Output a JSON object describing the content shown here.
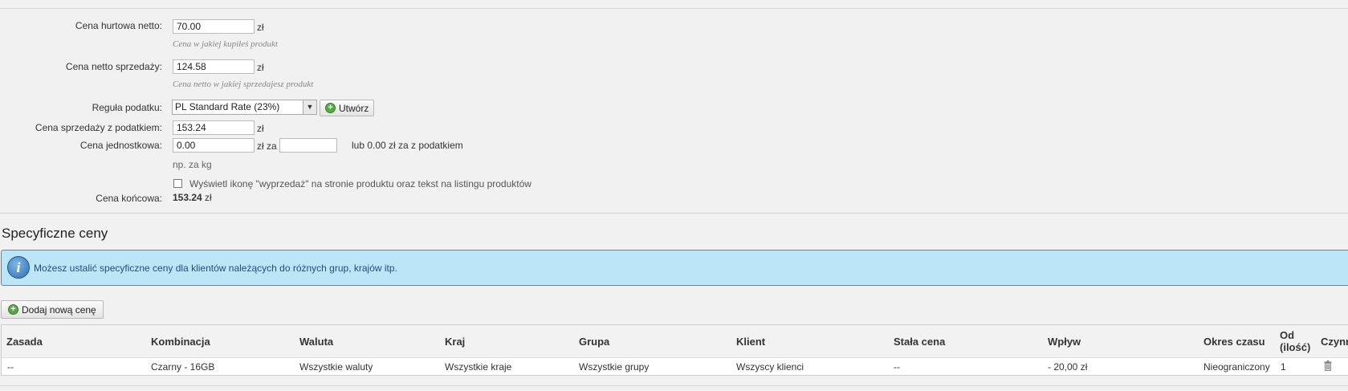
{
  "pricing": {
    "wholesale_label": "Cena hurtowa netto:",
    "wholesale_value": "70.00",
    "currency": "zł",
    "wholesale_hint": "Cena w jakiej kupiłeś produkt",
    "net_label": "Cena netto sprzedaży:",
    "net_value": "124.58",
    "net_hint": "Cena netto w jakiej sprzedajesz produkt",
    "tax_label": "Reguła podatku:",
    "tax_selected": "PL Standard Rate (23%)",
    "create_button": "Utwórz",
    "gross_label": "Cena sprzedaży z podatkiem:",
    "gross_value": "153.24",
    "unit_label": "Cena jednostkowa:",
    "unit_value": "0.00",
    "unit_za": "zł za",
    "unit_per_value": "",
    "unit_with_tax": "lub 0.00 zł za z podatkiem",
    "unit_example": "np. za kg",
    "onsale_label": "Wyświetl ikonę \"wyprzedaż\" na stronie produktu oraz tekst na listingu produktów",
    "onsale_checked": false,
    "final_label": "Cena końcowa:",
    "final_value": "153.24",
    "final_currency": "zł"
  },
  "specific": {
    "title": "Specyficzne ceny",
    "info": "Możesz ustalić specyficzne ceny dla klientów należących do różnych grup, krajów itp.",
    "add_button": "Dodaj nową cenę"
  },
  "table": {
    "headers": [
      "Zasada",
      "Kombinacja",
      "Waluta",
      "Kraj",
      "Grupa",
      "Klient",
      "Stała cena",
      "Wpływ",
      "Okres czasu",
      "Od\n(ilość)",
      "Czynn"
    ],
    "row": [
      "--",
      "Czarny - 16GB",
      "Wszystkie waluty",
      "Wszystkie kraje",
      "Wszystkie grupy",
      "Wszyscy klienci",
      "--",
      "- 20,00 zł",
      "Nieograniczony",
      "1"
    ]
  },
  "colors": {
    "info_bg": "#bde5f8",
    "info_border": "#4a8db8",
    "add_icon": "#5aa845"
  }
}
